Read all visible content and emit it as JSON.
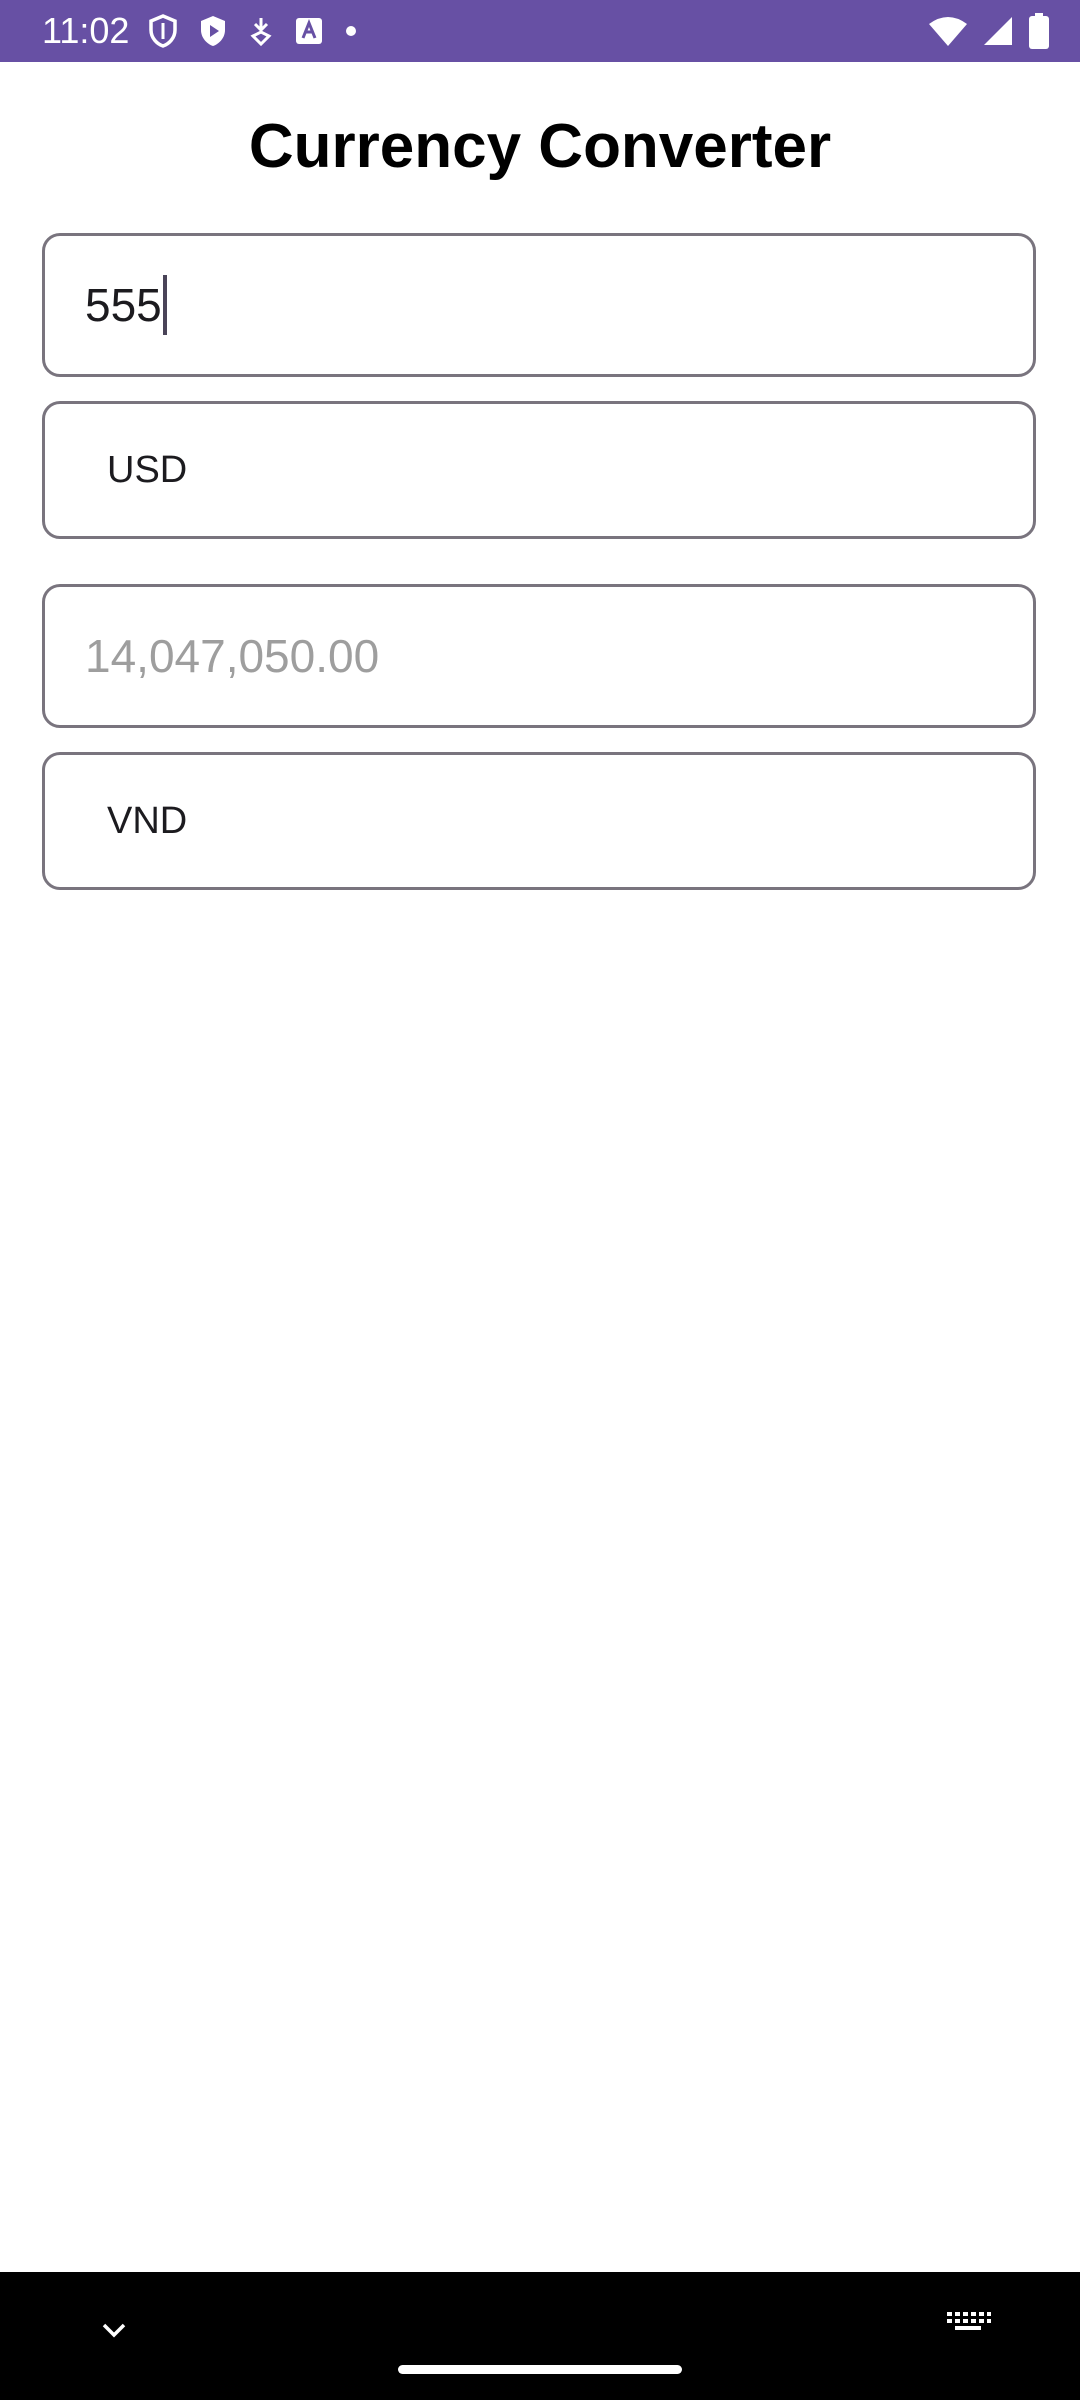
{
  "status_bar": {
    "time": "11:02",
    "left_icons": [
      "shield-outline-icon",
      "play-shield-icon",
      "download-icon",
      "font-icon",
      "dot-icon"
    ],
    "right_icons": [
      "wifi-icon",
      "signal-icon",
      "battery-icon"
    ],
    "background": "#6750a4"
  },
  "header": {
    "title": "Currency Converter"
  },
  "converter": {
    "amount_value": "555",
    "from_currency": "USD",
    "result_value": "14,047,050.00",
    "to_currency": "VND"
  },
  "nav_bar": {
    "icons": [
      "chevron-down-icon",
      "home-handle",
      "keyboard-icon"
    ]
  }
}
